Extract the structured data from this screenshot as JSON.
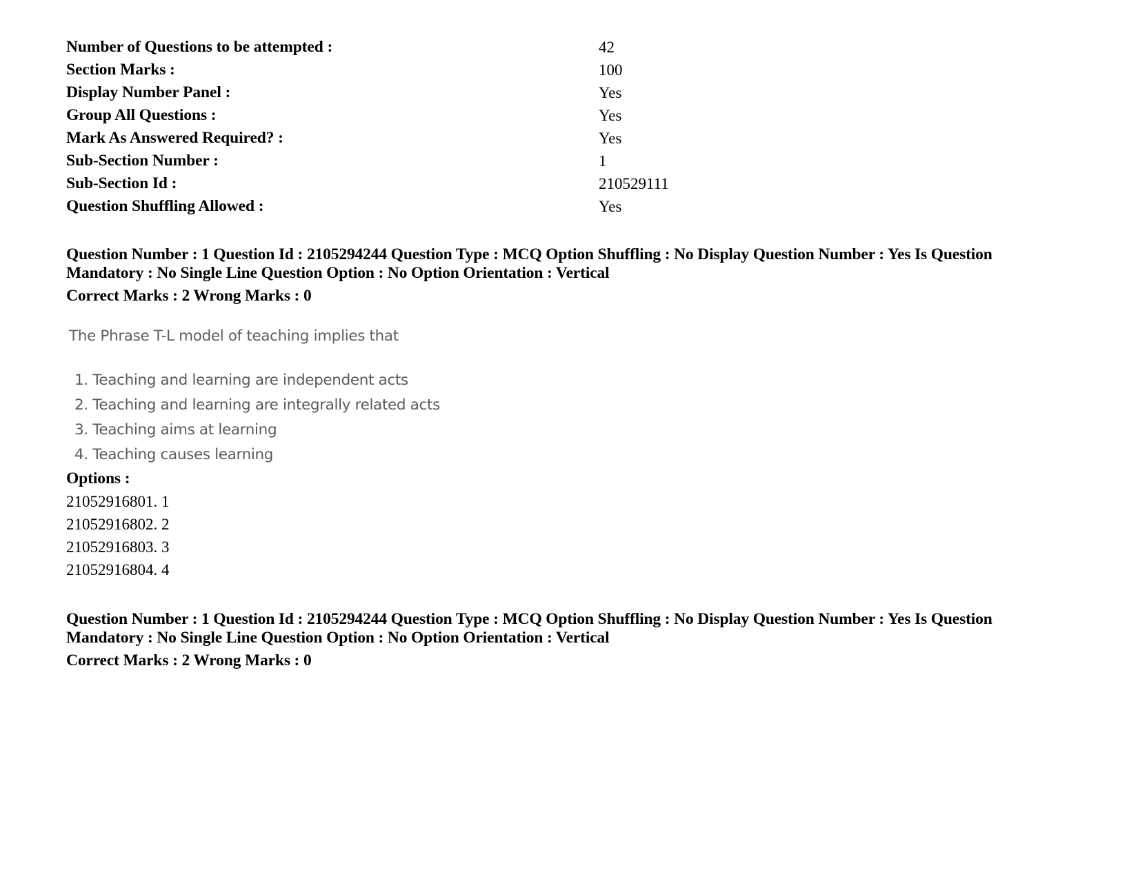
{
  "section_meta": {
    "rows": [
      {
        "label": "Number of Questions to be attempted :",
        "value": "42"
      },
      {
        "label": "Section Marks :",
        "value": "100"
      },
      {
        "label": "Display Number Panel :",
        "value": "Yes"
      },
      {
        "label": "Group All Questions :",
        "value": "Yes"
      },
      {
        "label": "Mark As Answered Required? :",
        "value": "Yes"
      },
      {
        "label": "Sub-Section Number :",
        "value": "1"
      },
      {
        "label": "Sub-Section Id :",
        "value": "210529111"
      },
      {
        "label": "Question Shuffling Allowed :",
        "value": "Yes"
      }
    ]
  },
  "question_meta_top": {
    "line1": "Question Number : 1 Question Id : 2105294244 Question Type : MCQ Option Shuffling : No Display Question Number : Yes Is Question Mandatory : No Single Line Question Option : No Option Orientation : Vertical",
    "marks": "Correct Marks : 2 Wrong Marks : 0"
  },
  "question_body": {
    "stem": "The Phrase T-L model of teaching implies that",
    "choices": [
      "1. Teaching and learning are independent acts",
      "2. Teaching and learning are integrally related acts",
      "3. Teaching aims at learning",
      "4. Teaching causes learning"
    ]
  },
  "options": {
    "label": "Options :",
    "items": [
      "21052916801. 1",
      "21052916802. 2",
      "21052916803. 3",
      "21052916804. 4"
    ]
  },
  "question_meta_bottom": {
    "line1": "Question Number : 1 Question Id : 2105294244 Question Type : MCQ Option Shuffling : No Display Question Number : Yes Is Question Mandatory : No Single Line Question Option : No Option Orientation : Vertical",
    "marks": "Correct Marks : 2 Wrong Marks : 0"
  }
}
